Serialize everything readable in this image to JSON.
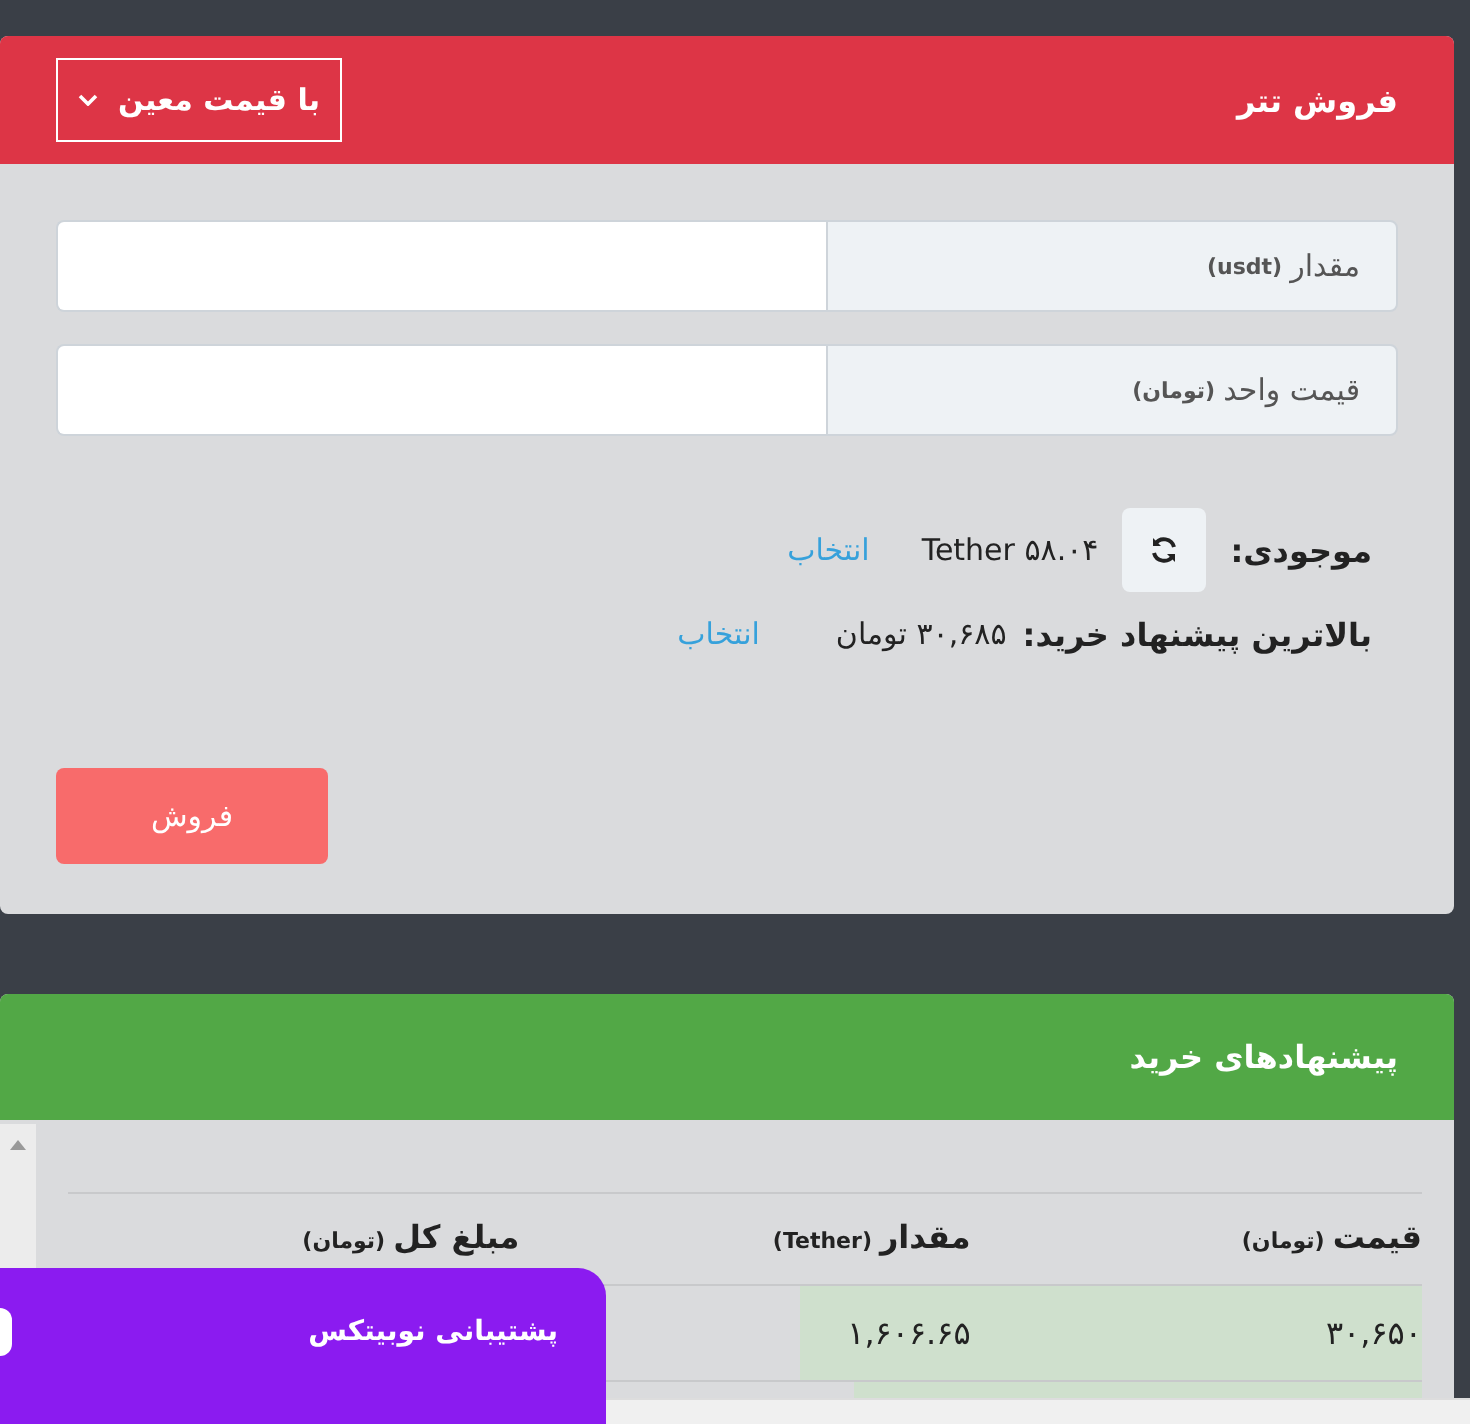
{
  "sell_card": {
    "title": "فروش تتر",
    "order_type": "با قیمت معین",
    "fields": [
      {
        "label": "مقدار",
        "unit": "(usdt)"
      },
      {
        "label": "قیمت واحد",
        "unit": "(تومان)"
      }
    ],
    "balance": {
      "label": "موجودی:",
      "value": "Tether ۵۸.۰۴",
      "link": "انتخاب"
    },
    "best_bid": {
      "label": "بالاترین پیشنهاد خرید:",
      "value": "۳۰,۶۸۵ تومان",
      "link": "انتخاب"
    },
    "submit": "فروش"
  },
  "bids_card": {
    "title": "پیشنهادهای خرید",
    "columns": [
      {
        "label": "قیمت",
        "unit": "(تومان)"
      },
      {
        "label": "مقدار",
        "unit": "(Tether)"
      },
      {
        "label": "مبلغ کل",
        "unit": "(تومان)"
      }
    ],
    "rows": [
      {
        "price": "۳۰,۶۵۰",
        "amount": "۱,۶۰۶.۶۵",
        "level": 0.46
      },
      {
        "level": 0.42
      }
    ]
  },
  "support_widget": {
    "label": "پشتیبانی نوبیتکس"
  }
}
